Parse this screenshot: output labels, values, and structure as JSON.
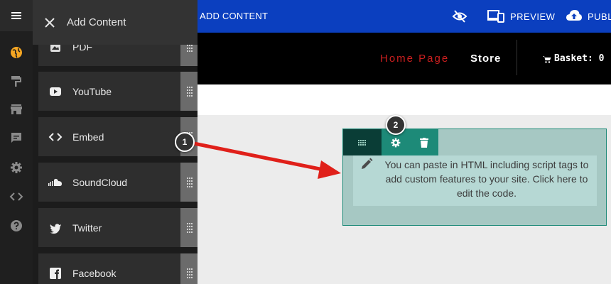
{
  "panel": {
    "title": "Add Content",
    "items": [
      {
        "label": "PDF",
        "icon": "pdf-icon"
      },
      {
        "label": "YouTube",
        "icon": "youtube-icon"
      },
      {
        "label": "Embed",
        "icon": "code-icon"
      },
      {
        "label": "SoundCloud",
        "icon": "soundcloud-icon"
      },
      {
        "label": "Twitter",
        "icon": "twitter-icon"
      },
      {
        "label": "Facebook",
        "icon": "facebook-icon"
      }
    ]
  },
  "topbar": {
    "add_content": "ADD CONTENT",
    "preview": "PREVIEW",
    "publish": "PUBL"
  },
  "site_nav": {
    "home": "Home Page",
    "store": "Store",
    "basket": "Basket: 0"
  },
  "embed_block": {
    "text": "You can paste in HTML including script tags to add custom features to your site. Click here to edit the code."
  },
  "callouts": {
    "one": "1",
    "two": "2"
  },
  "colors": {
    "topbar": "#0b3fbf",
    "home_link": "#cc1f1f",
    "block_accent": "#1d8a78",
    "arrow": "#e0201a",
    "rail_accent": "#f5a623"
  }
}
